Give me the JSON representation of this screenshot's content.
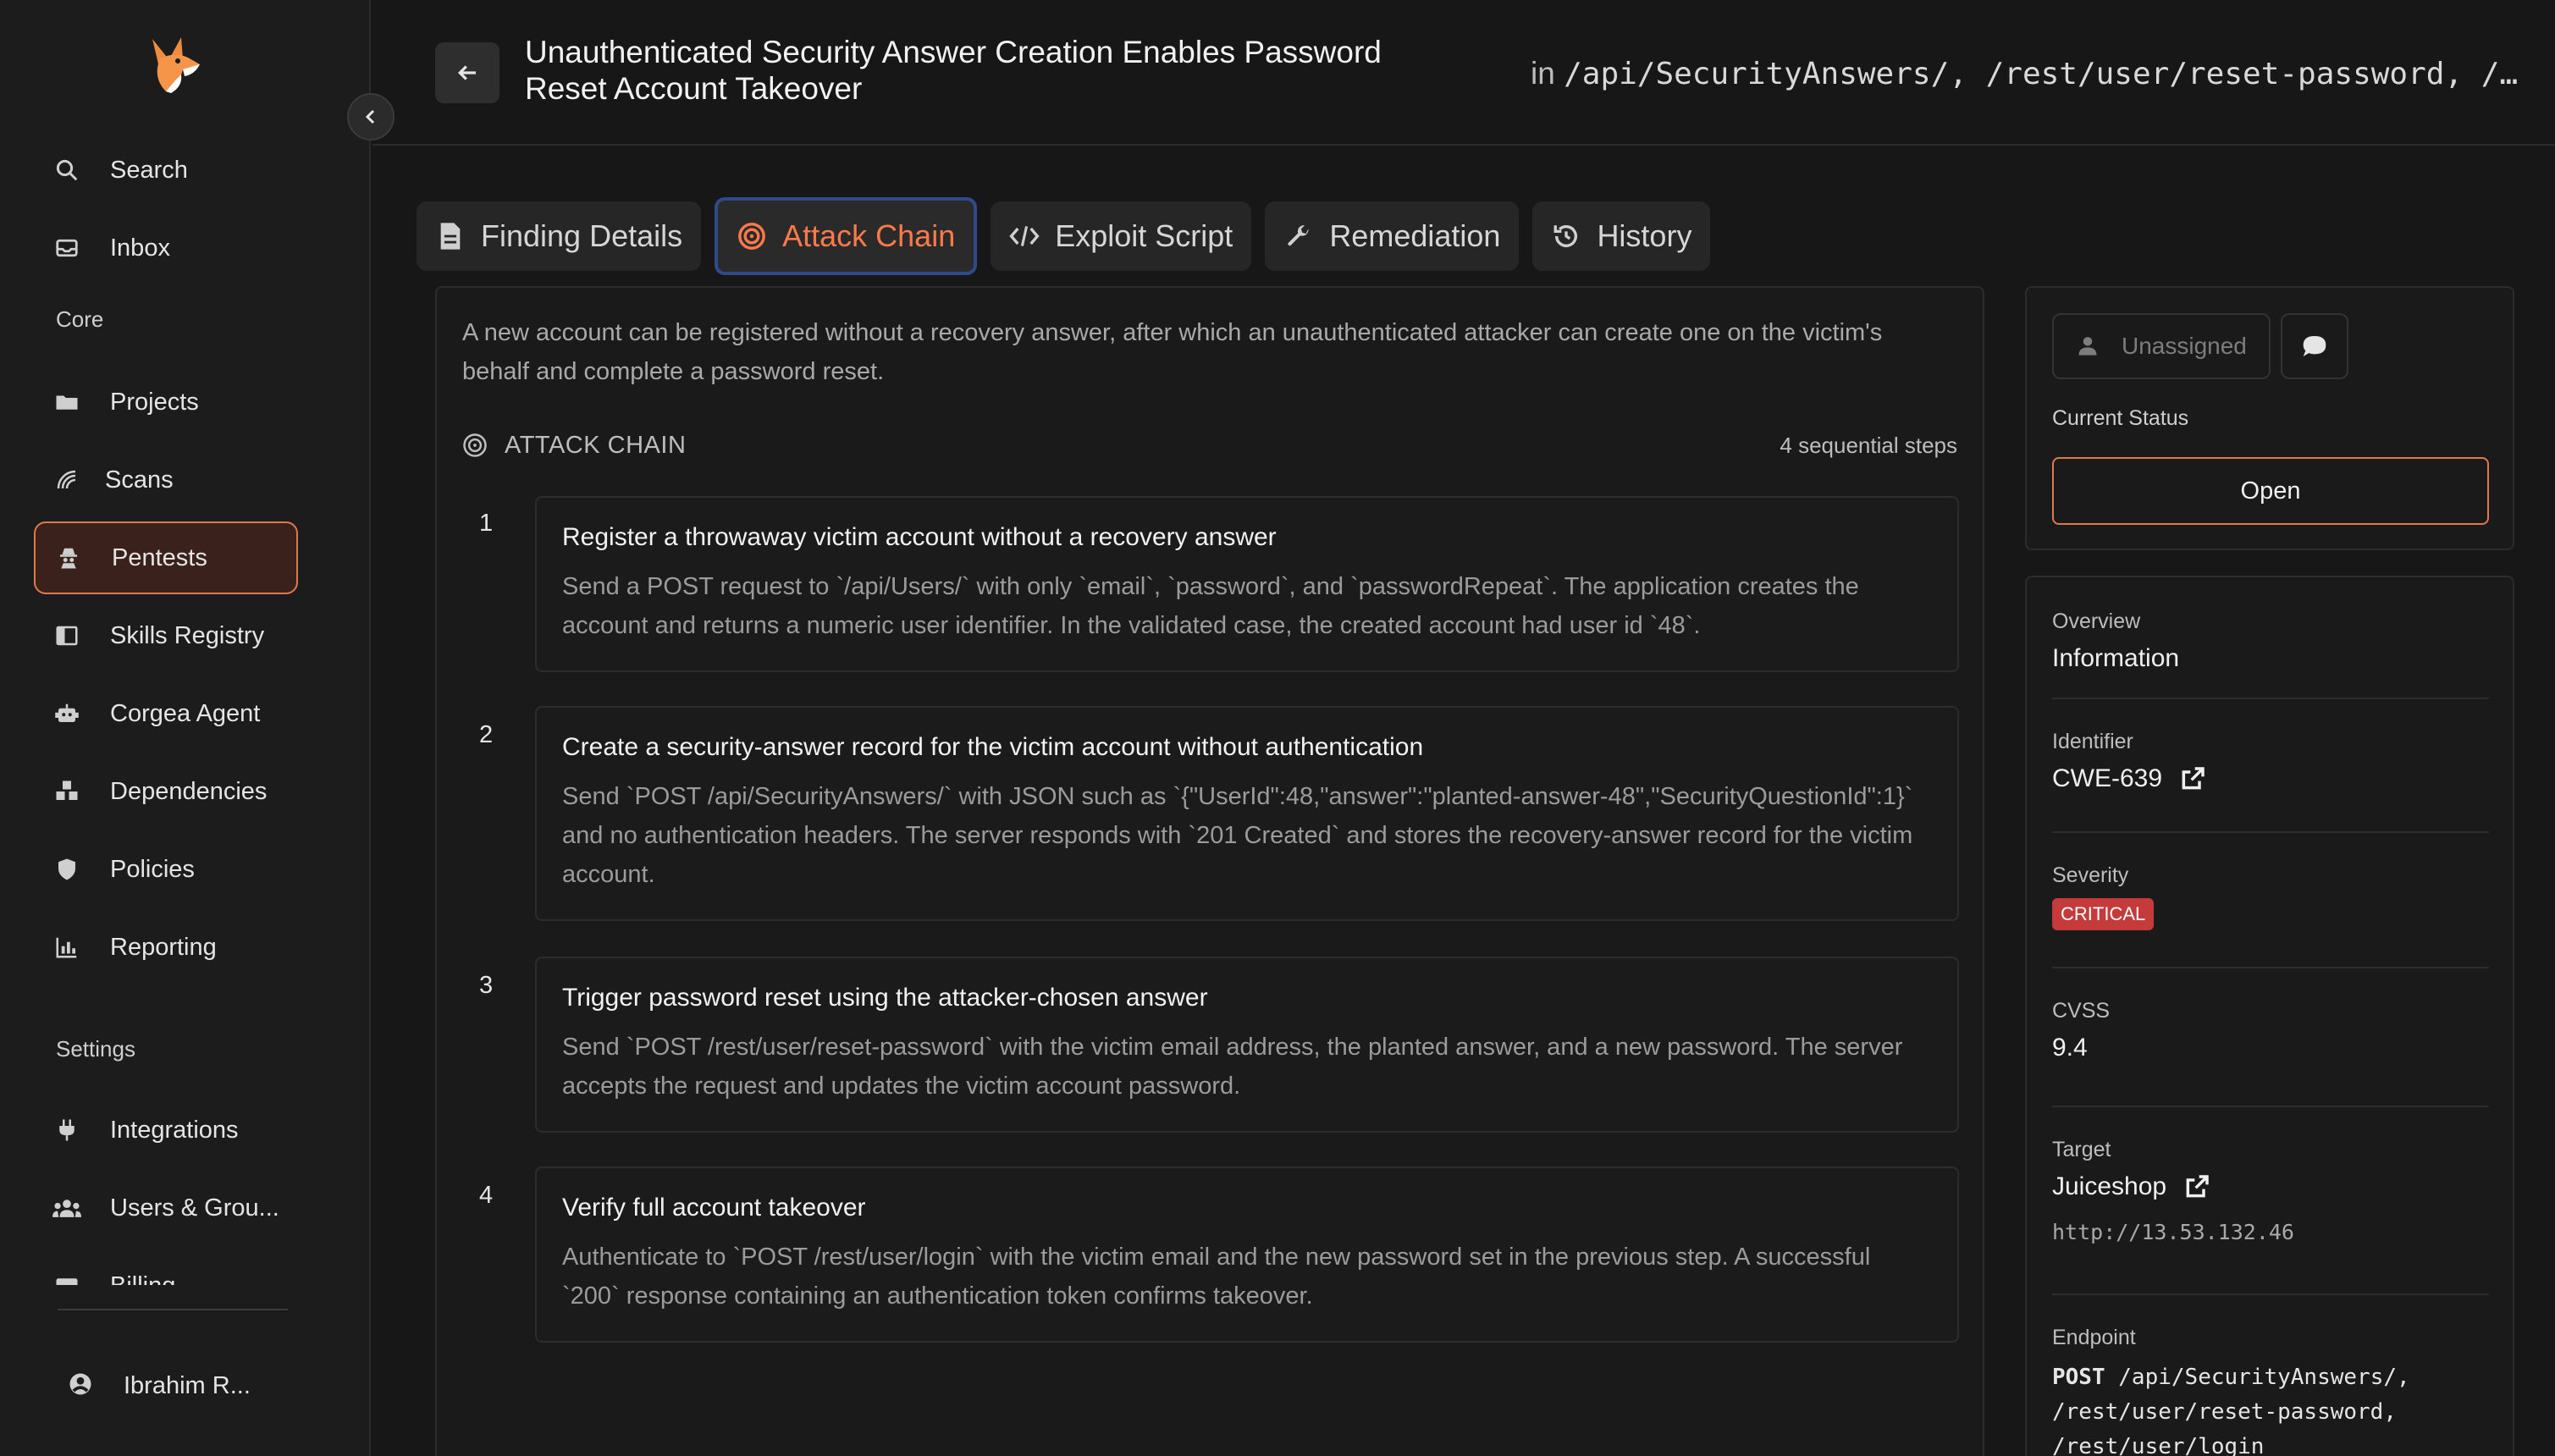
{
  "sidebar": {
    "items_top": [
      {
        "label": "Search",
        "icon": "search-icon"
      },
      {
        "label": "Inbox",
        "icon": "inbox-icon"
      }
    ],
    "core_label": "Core",
    "core_items": [
      {
        "label": "Projects",
        "icon": "folder-icon"
      },
      {
        "label": "Scans",
        "icon": "radar-icon"
      },
      {
        "label": "Pentests",
        "icon": "spy-icon"
      },
      {
        "label": "Skills Registry",
        "icon": "book-icon"
      },
      {
        "label": "Corgea Agent",
        "icon": "robot-icon"
      },
      {
        "label": "Dependencies",
        "icon": "cubes-icon"
      },
      {
        "label": "Policies",
        "icon": "shield-icon"
      },
      {
        "label": "Reporting",
        "icon": "chart-icon"
      }
    ],
    "settings_label": "Settings",
    "settings_items": [
      {
        "label": "Integrations",
        "icon": "plug-icon"
      },
      {
        "label": "Users & Grou...",
        "icon": "users-icon"
      },
      {
        "label": "Billing",
        "icon": "card-icon"
      }
    ],
    "user_name": "Ibrahim R..."
  },
  "header": {
    "title": "Unauthenticated Security Answer Creation Enables Password Reset Account Takeover",
    "in_label": "in",
    "in_paths": "/api/SecurityAnswers/, /rest/user/reset-password, /…"
  },
  "tabs": [
    {
      "label": "Finding Details",
      "icon": "document-icon"
    },
    {
      "label": "Attack Chain",
      "icon": "target-icon"
    },
    {
      "label": "Exploit Script",
      "icon": "code-icon"
    },
    {
      "label": "Remediation",
      "icon": "wrench-icon"
    },
    {
      "label": "History",
      "icon": "history-icon"
    }
  ],
  "main": {
    "intro": "A new account can be registered without a recovery answer, after which an unauthenticated attacker can create one on the victim's behalf and complete a password reset.",
    "chain_label": "ATTACK CHAIN",
    "chain_count": "4 sequential steps",
    "steps": [
      {
        "num": "1",
        "title": "Register a throwaway victim account without a recovery answer",
        "desc": "Send a POST request to `/api/Users/` with only `email`, `password`, and `passwordRepeat`. The application creates the account and returns a numeric user identifier. In the validated case, the created account had user id `48`."
      },
      {
        "num": "2",
        "title": "Create a security-answer record for the victim account without authentication",
        "desc": "Send `POST /api/SecurityAnswers/` with JSON such as `{\"UserId\":48,\"answer\":\"planted-answer-48\",\"SecurityQuestionId\":1}` and no authentication headers. The server responds with `201 Created` and stores the recovery-answer record for the victim account."
      },
      {
        "num": "3",
        "title": "Trigger password reset using the attacker-chosen answer",
        "desc": "Send `POST /rest/user/reset-password` with the victim email address, the planted answer, and a new password. The server accepts the request and updates the victim account password."
      },
      {
        "num": "4",
        "title": "Verify full account takeover",
        "desc": "Authenticate to `POST /rest/user/login` with the victim email and the new password set in the previous step. A successful `200` response containing an authentication token confirms takeover."
      }
    ]
  },
  "right": {
    "assignee": "Unassigned",
    "status_label": "Current Status",
    "status_value": "Open",
    "overview_label": "Overview",
    "overview_value": "Information",
    "identifier_label": "Identifier",
    "identifier_value": "CWE-639",
    "severity_label": "Severity",
    "severity_value": "CRITICAL",
    "cvss_label": "CVSS",
    "cvss_value": "9.4",
    "target_label": "Target",
    "target_value": "Juiceshop",
    "target_url": "http://13.53.132.46",
    "endpoint_label": "Endpoint",
    "endpoint_method": "POST",
    "endpoint_line1": " /api/SecurityAnswers/,",
    "endpoint_line2": "/rest/user/reset-password,",
    "endpoint_line3": "/rest/user/login"
  },
  "colors": {
    "accent": "#e0784f",
    "active_tab_text": "#ff7a4a",
    "critical": "#c53b3b",
    "background": "#171717"
  }
}
